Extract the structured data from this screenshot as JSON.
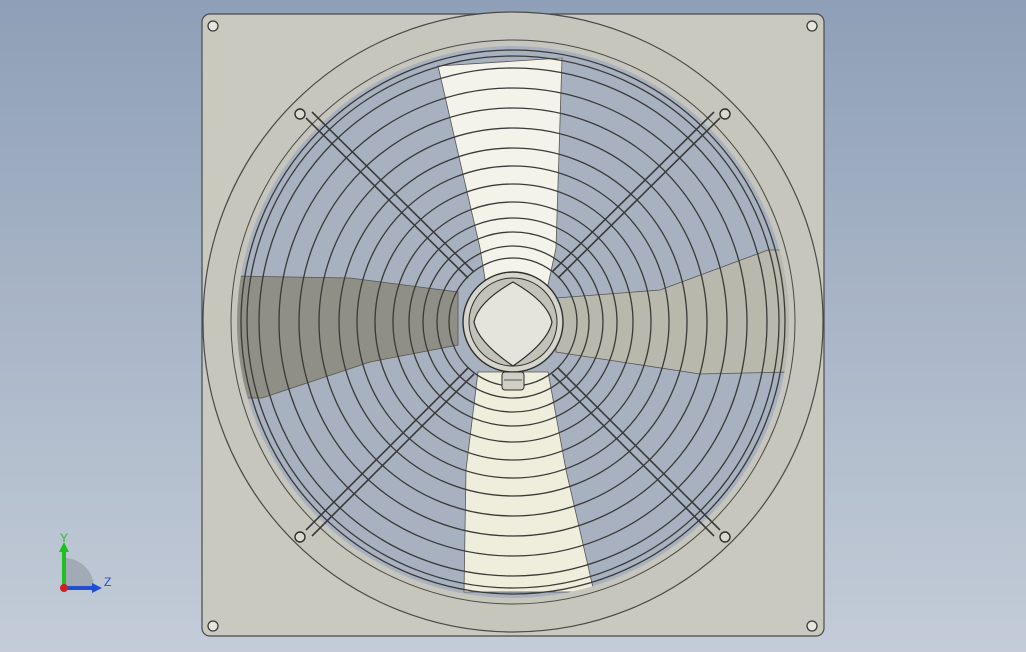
{
  "viewport": {
    "background_top": "#8e9fb7",
    "background_bottom": "#c3ccd8",
    "model": "axial-fan-assembly"
  },
  "colors": {
    "panel": "#c9c9c0",
    "panel_edge": "#4a4a48",
    "blade_light": "#f4f3ea",
    "blade_shade": "#8f8f86",
    "wire": "#3a3a38",
    "axis_y": "#20c020",
    "axis_z": "#2050d0",
    "axis_x": "#d02020"
  },
  "triad": {
    "y_label": "Y",
    "z_label": "Z",
    "icon": "coordinate-triad-icon"
  }
}
